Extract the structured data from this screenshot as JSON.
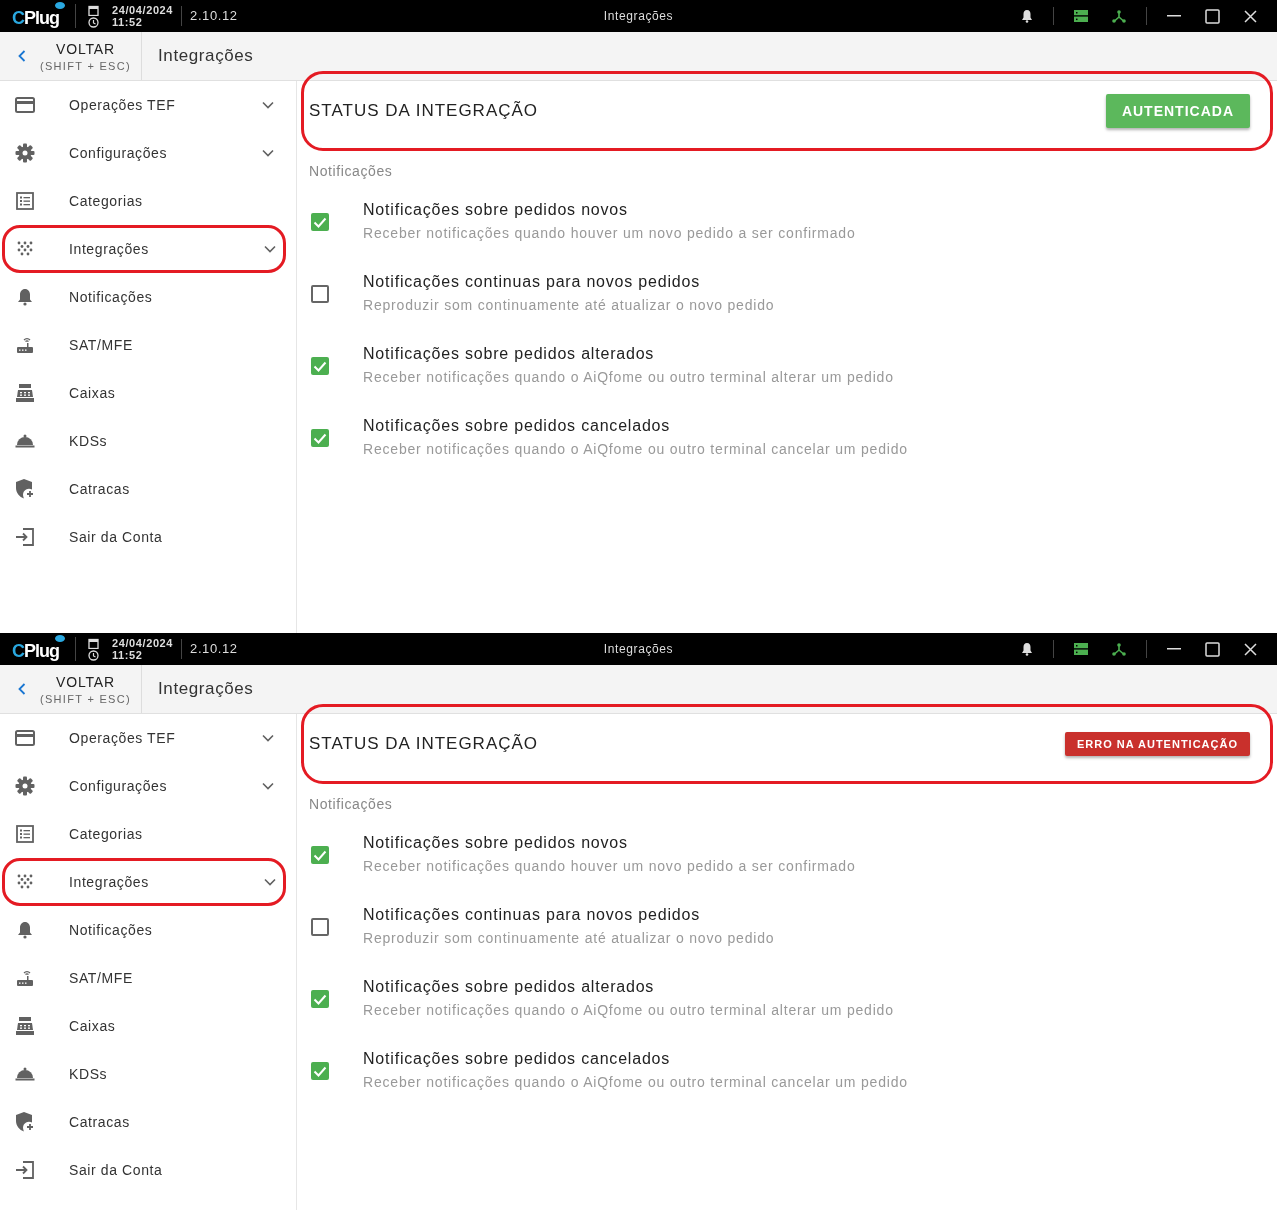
{
  "screens": [
    {
      "titlebar": {
        "logo": "CPlug",
        "date": "24/04/2024",
        "time": "11:52",
        "version": "2.10.12",
        "title": "Integrações"
      },
      "header": {
        "back_label": "VOLTAR",
        "back_shortcut": "(SHIFT + ESC)",
        "page_title": "Integrações"
      },
      "sidebar": {
        "items": [
          {
            "label": "Operações TEF",
            "expandable": true,
            "highlighted": false
          },
          {
            "label": "Configurações",
            "expandable": true,
            "highlighted": false
          },
          {
            "label": "Categorias",
            "expandable": false,
            "highlighted": false
          },
          {
            "label": "Integrações",
            "expandable": true,
            "highlighted": true
          },
          {
            "label": "Notificações",
            "expandable": false,
            "highlighted": false
          },
          {
            "label": "SAT/MFE",
            "expandable": false,
            "highlighted": false
          },
          {
            "label": "Caixas",
            "expandable": false,
            "highlighted": false
          },
          {
            "label": "KDSs",
            "expandable": false,
            "highlighted": false
          },
          {
            "label": "Catracas",
            "expandable": false,
            "highlighted": false
          },
          {
            "label": "Sair da Conta",
            "expandable": false,
            "highlighted": false
          }
        ]
      },
      "status": {
        "title": "STATUS DA INTEGRAÇÃO",
        "kind": "success",
        "label": "AUTENTICADA",
        "highlighted": true
      },
      "notifications": {
        "heading": "Notificações",
        "items": [
          {
            "title": "Notificações sobre pedidos novos",
            "description": "Receber notificações quando houver um novo pedido a ser confirmado",
            "checked": true
          },
          {
            "title": "Notificações continuas para novos pedidos",
            "description": "Reproduzir som continuamente até atualizar o novo pedido",
            "checked": false
          },
          {
            "title": "Notificações sobre pedidos alterados",
            "description": "Receber notificações quando o AiQfome ou outro terminal alterar um pedido",
            "checked": true
          },
          {
            "title": "Notificações sobre pedidos cancelados",
            "description": "Receber notificações quando o AiQfome ou outro terminal cancelar um pedido",
            "checked": true
          }
        ]
      }
    },
    {
      "titlebar": {
        "logo": "CPlug",
        "date": "24/04/2024",
        "time": "11:52",
        "version": "2.10.12",
        "title": "Integrações"
      },
      "header": {
        "back_label": "VOLTAR",
        "back_shortcut": "(SHIFT + ESC)",
        "page_title": "Integrações"
      },
      "sidebar": {
        "items": [
          {
            "label": "Operações TEF",
            "expandable": true,
            "highlighted": false
          },
          {
            "label": "Configurações",
            "expandable": true,
            "highlighted": false
          },
          {
            "label": "Categorias",
            "expandable": false,
            "highlighted": false
          },
          {
            "label": "Integrações",
            "expandable": true,
            "highlighted": true
          },
          {
            "label": "Notificações",
            "expandable": false,
            "highlighted": false
          },
          {
            "label": "SAT/MFE",
            "expandable": false,
            "highlighted": false
          },
          {
            "label": "Caixas",
            "expandable": false,
            "highlighted": false
          },
          {
            "label": "KDSs",
            "expandable": false,
            "highlighted": false
          },
          {
            "label": "Catracas",
            "expandable": false,
            "highlighted": false
          },
          {
            "label": "Sair da Conta",
            "expandable": false,
            "highlighted": false
          }
        ]
      },
      "status": {
        "title": "STATUS DA INTEGRAÇÃO",
        "kind": "error",
        "label": "ERRO NA AUTENTICAÇÃO",
        "highlighted": true
      },
      "notifications": {
        "heading": "Notificações",
        "items": [
          {
            "title": "Notificações sobre pedidos novos",
            "description": "Receber notificações quando houver um novo pedido a ser confirmado",
            "checked": true
          },
          {
            "title": "Notificações continuas para novos pedidos",
            "description": "Reproduzir som continuamente até atualizar o novo pedido",
            "checked": false
          },
          {
            "title": "Notificações sobre pedidos alterados",
            "description": "Receber notificações quando o AiQfome ou outro terminal alterar um pedido",
            "checked": true
          },
          {
            "title": "Notificações sobre pedidos cancelados",
            "description": "Receber notificações quando o AiQfome ou outro terminal cancelar um pedido",
            "checked": true
          }
        ]
      }
    }
  ]
}
